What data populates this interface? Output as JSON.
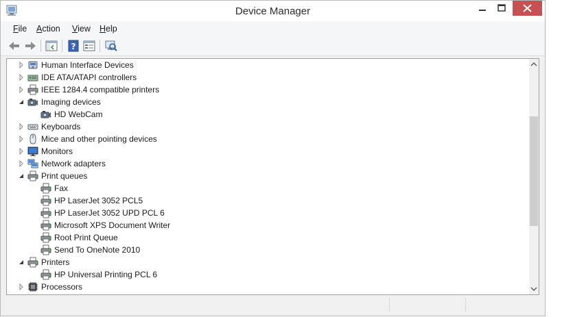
{
  "window": {
    "title": "Device Manager"
  },
  "menu": [
    {
      "label": "File"
    },
    {
      "label": "Action"
    },
    {
      "label": "View"
    },
    {
      "label": "Help"
    }
  ],
  "toolbar": [
    {
      "icon": "back-arrow-icon"
    },
    {
      "icon": "forward-arrow-icon"
    },
    {
      "icon": "show-hide-console-tree-icon"
    },
    {
      "icon": "help-icon"
    },
    {
      "icon": "properties-icon"
    },
    {
      "icon": "scan-hardware-changes-icon"
    }
  ],
  "tree": [
    {
      "label": "Human Interface Devices",
      "level": 0,
      "state": "collapsed",
      "icon": "hid-icon"
    },
    {
      "label": "IDE ATA/ATAPI controllers",
      "level": 0,
      "state": "collapsed",
      "icon": "ide-controller-icon"
    },
    {
      "label": "IEEE 1284.4 compatible printers",
      "level": 0,
      "state": "collapsed",
      "icon": "printer-icon"
    },
    {
      "label": "Imaging devices",
      "level": 0,
      "state": "expanded",
      "icon": "camera-icon"
    },
    {
      "label": "HD WebCam",
      "level": 1,
      "state": "leaf",
      "icon": "camera-icon"
    },
    {
      "label": "Keyboards",
      "level": 0,
      "state": "collapsed",
      "icon": "keyboard-icon"
    },
    {
      "label": "Mice and other pointing devices",
      "level": 0,
      "state": "collapsed",
      "icon": "mouse-icon"
    },
    {
      "label": "Monitors",
      "level": 0,
      "state": "collapsed",
      "icon": "monitor-icon"
    },
    {
      "label": "Network adapters",
      "level": 0,
      "state": "collapsed",
      "icon": "network-adapter-icon"
    },
    {
      "label": "Print queues",
      "level": 0,
      "state": "expanded",
      "icon": "printer-icon"
    },
    {
      "label": "Fax",
      "level": 1,
      "state": "leaf",
      "icon": "printer-icon"
    },
    {
      "label": "HP LaserJet 3052 PCL5",
      "level": 1,
      "state": "leaf",
      "icon": "printer-icon"
    },
    {
      "label": "HP LaserJet 3052 UPD PCL 6",
      "level": 1,
      "state": "leaf",
      "icon": "printer-icon"
    },
    {
      "label": "Microsoft XPS Document Writer",
      "level": 1,
      "state": "leaf",
      "icon": "printer-icon"
    },
    {
      "label": "Root Print Queue",
      "level": 1,
      "state": "leaf",
      "icon": "printer-icon"
    },
    {
      "label": "Send To OneNote 2010",
      "level": 1,
      "state": "leaf",
      "icon": "printer-icon"
    },
    {
      "label": "Printers",
      "level": 0,
      "state": "expanded",
      "icon": "printer-icon"
    },
    {
      "label": "HP Universal Printing PCL 6",
      "level": 1,
      "state": "leaf",
      "icon": "printer-icon"
    },
    {
      "label": "Processors",
      "level": 0,
      "state": "collapsed",
      "icon": "processor-icon"
    }
  ],
  "colors": {
    "close_button": "#c75050",
    "selection": "#cce8ff"
  }
}
